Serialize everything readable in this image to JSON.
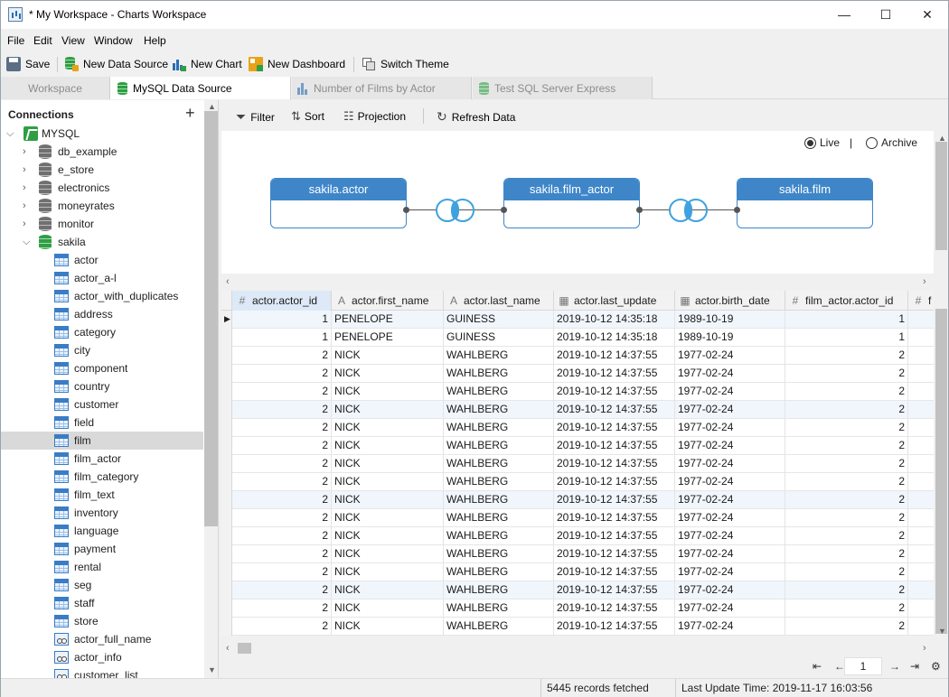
{
  "window": {
    "title": "* My Workspace - Charts Workspace",
    "buttons": {
      "minimize": "—",
      "maximize": "☐",
      "close": "✕"
    }
  },
  "menu": [
    "File",
    "Edit",
    "View",
    "Window",
    "Help"
  ],
  "toolbar": {
    "save": "Save",
    "new_data_source": "New Data Source",
    "new_chart": "New Chart",
    "new_dashboard": "New Dashboard",
    "switch_theme": "Switch Theme"
  },
  "tabs": [
    {
      "label": "Workspace",
      "active": false
    },
    {
      "label": "MySQL Data Source",
      "active": true
    },
    {
      "label": "Number of Films by Actor",
      "active": false
    },
    {
      "label": "Test SQL Server Express",
      "active": false
    }
  ],
  "connections": {
    "title": "Connections",
    "add": "+",
    "root": "MYSQL",
    "databases": [
      "db_example",
      "e_store",
      "electronics",
      "moneyrates",
      "monitor",
      "sakila"
    ],
    "tables": [
      "actor",
      "actor_a-l",
      "actor_with_duplicates",
      "address",
      "category",
      "city",
      "component",
      "country",
      "customer",
      "field",
      "film",
      "film_actor",
      "film_category",
      "film_text",
      "inventory",
      "language",
      "payment",
      "rental",
      "seg",
      "staff",
      "store"
    ],
    "views": [
      "actor_full_name",
      "actor_info",
      "customer_list"
    ],
    "selected": "film"
  },
  "data_toolbar": {
    "filter": "Filter",
    "sort": "Sort",
    "projection": "Projection",
    "refresh": "Refresh Data"
  },
  "mode": {
    "live": "Live",
    "separator": "|",
    "archive": "Archive",
    "selected": "live"
  },
  "diagram": {
    "nodes": [
      "sakila.actor",
      "sakila.film_actor",
      "sakila.film"
    ]
  },
  "grid": {
    "columns": [
      {
        "name": "actor.actor_id",
        "icon": "#"
      },
      {
        "name": "actor.first_name",
        "icon": "A"
      },
      {
        "name": "actor.last_name",
        "icon": "A"
      },
      {
        "name": "actor.last_update",
        "icon": "cal"
      },
      {
        "name": "actor.birth_date",
        "icon": "cal"
      },
      {
        "name": "film_actor.actor_id",
        "icon": "#"
      },
      {
        "name": "f",
        "icon": "#"
      }
    ],
    "rows": [
      [
        "1",
        "PENELOPE",
        "GUINESS",
        "2019-10-12 14:35:18",
        "1989-10-19",
        "1"
      ],
      [
        "1",
        "PENELOPE",
        "GUINESS",
        "2019-10-12 14:35:18",
        "1989-10-19",
        "1"
      ],
      [
        "2",
        "NICK",
        "WAHLBERG",
        "2019-10-12 14:37:55",
        "1977-02-24",
        "2"
      ],
      [
        "2",
        "NICK",
        "WAHLBERG",
        "2019-10-12 14:37:55",
        "1977-02-24",
        "2"
      ],
      [
        "2",
        "NICK",
        "WAHLBERG",
        "2019-10-12 14:37:55",
        "1977-02-24",
        "2"
      ],
      [
        "2",
        "NICK",
        "WAHLBERG",
        "2019-10-12 14:37:55",
        "1977-02-24",
        "2"
      ],
      [
        "2",
        "NICK",
        "WAHLBERG",
        "2019-10-12 14:37:55",
        "1977-02-24",
        "2"
      ],
      [
        "2",
        "NICK",
        "WAHLBERG",
        "2019-10-12 14:37:55",
        "1977-02-24",
        "2"
      ],
      [
        "2",
        "NICK",
        "WAHLBERG",
        "2019-10-12 14:37:55",
        "1977-02-24",
        "2"
      ],
      [
        "2",
        "NICK",
        "WAHLBERG",
        "2019-10-12 14:37:55",
        "1977-02-24",
        "2"
      ],
      [
        "2",
        "NICK",
        "WAHLBERG",
        "2019-10-12 14:37:55",
        "1977-02-24",
        "2"
      ],
      [
        "2",
        "NICK",
        "WAHLBERG",
        "2019-10-12 14:37:55",
        "1977-02-24",
        "2"
      ],
      [
        "2",
        "NICK",
        "WAHLBERG",
        "2019-10-12 14:37:55",
        "1977-02-24",
        "2"
      ],
      [
        "2",
        "NICK",
        "WAHLBERG",
        "2019-10-12 14:37:55",
        "1977-02-24",
        "2"
      ],
      [
        "2",
        "NICK",
        "WAHLBERG",
        "2019-10-12 14:37:55",
        "1977-02-24",
        "2"
      ],
      [
        "2",
        "NICK",
        "WAHLBERG",
        "2019-10-12 14:37:55",
        "1977-02-24",
        "2"
      ],
      [
        "2",
        "NICK",
        "WAHLBERG",
        "2019-10-12 14:37:55",
        "1977-02-24",
        "2"
      ],
      [
        "2",
        "NICK",
        "WAHLBERG",
        "2019-10-12 14:37:55",
        "1977-02-24",
        "2"
      ]
    ]
  },
  "pager": {
    "page": "1"
  },
  "status": {
    "records": "5445 records fetched",
    "last_update": "Last Update Time: 2019-11-17 16:03:56"
  },
  "colors": {
    "accent": "#3f86c9",
    "join": "#3fa2de",
    "green": "#2f9e44"
  }
}
